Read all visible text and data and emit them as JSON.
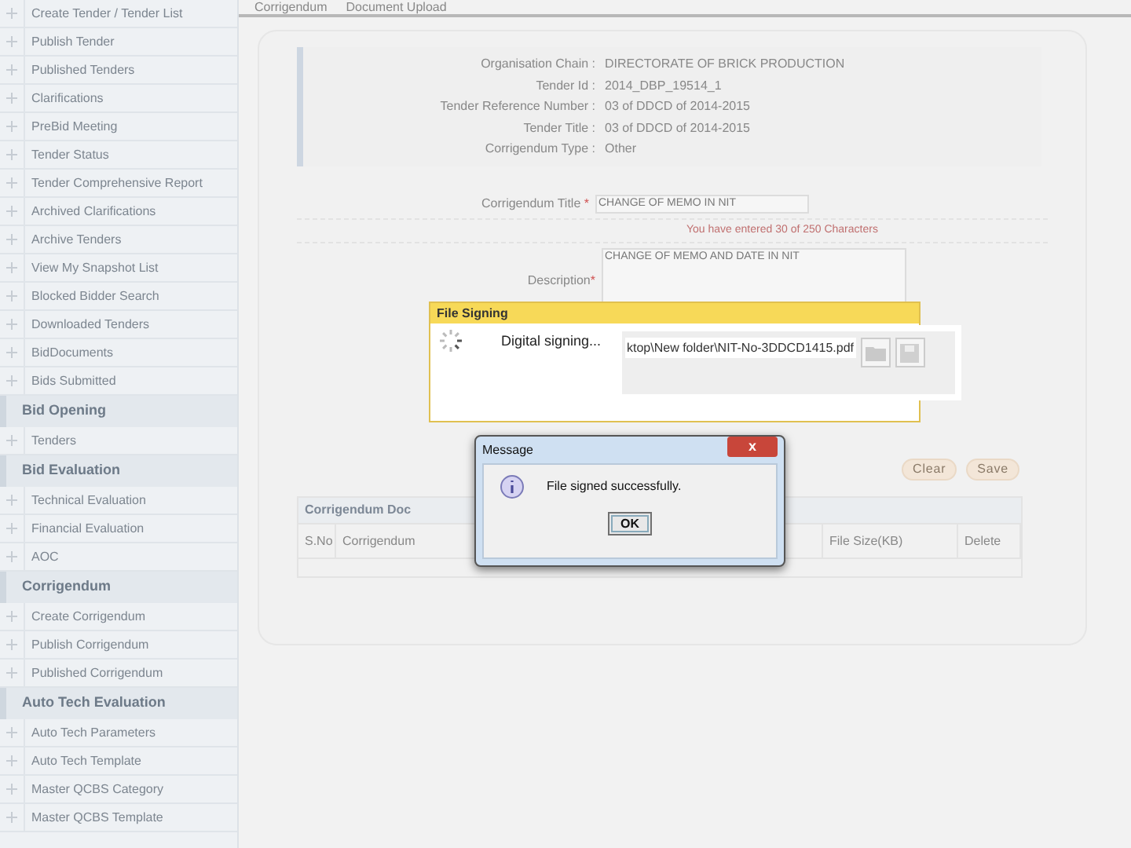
{
  "breadcrumb": [
    "Corrigendum",
    "Document Upload"
  ],
  "sidebar": {
    "groups": [
      {
        "items": [
          "Create Tender / Tender List",
          "Publish Tender",
          "Published Tenders",
          "Clarifications",
          "PreBid Meeting",
          "Tender Status",
          "Tender Comprehensive Report",
          "Archived Clarifications",
          "Archive Tenders",
          "View My Snapshot List",
          "Blocked Bidder Search",
          "Downloaded Tenders",
          "BidDocuments",
          "Bids Submitted"
        ]
      },
      {
        "heading": "Bid Opening",
        "items": [
          "Tenders"
        ]
      },
      {
        "heading": "Bid Evaluation",
        "items": [
          "Technical Evaluation",
          "Financial Evaluation",
          "AOC"
        ]
      },
      {
        "heading": "Corrigendum",
        "items": [
          "Create Corrigendum",
          "Publish Corrigendum",
          "Published Corrigendum"
        ]
      },
      {
        "heading": "Auto Tech Evaluation",
        "items": [
          "Auto Tech Parameters",
          "Auto Tech Template",
          "Master QCBS Category",
          "Master QCBS Template"
        ]
      }
    ]
  },
  "tender_info": [
    {
      "label": "Organisation Chain :",
      "value": "DIRECTORATE OF BRICK PRODUCTION"
    },
    {
      "label": "Tender Id :",
      "value": "2014_DBP_19514_1"
    },
    {
      "label": "Tender Reference Number :",
      "value": "03 of DDCD of 2014-2015"
    },
    {
      "label": "Tender Title :",
      "value": "03 of DDCD of 2014-2015"
    },
    {
      "label": "Corrigendum Type :",
      "value": "Other"
    }
  ],
  "form": {
    "required_mark": "*",
    "title_label": "Corrigendum Title",
    "title_value": "CHANGE OF MEMO IN NIT",
    "char_count": "You have entered 30  of 250 Characters",
    "description_label": "Description",
    "description_value": "CHANGE OF MEMO AND DATE IN NIT",
    "buttons": [
      "Clear",
      "Save"
    ]
  },
  "documents_table": {
    "title": "Corrigendum Doc",
    "columns": [
      "S.No",
      "Corrigendum",
      "File Size(KB)",
      "Delete"
    ]
  },
  "file_signing_dialog": {
    "title": "File Signing",
    "status": "Digital signing...",
    "file_path": "ktop\\New folder\\NIT-No-3DDCD1415.pdf"
  },
  "message_dialog": {
    "title": "Message",
    "close": "x",
    "text": "File signed successfully.",
    "button": "OK"
  }
}
